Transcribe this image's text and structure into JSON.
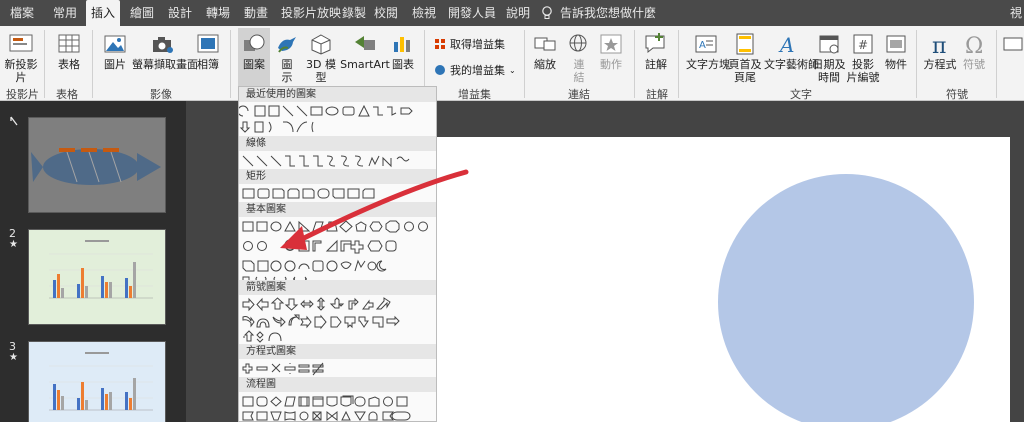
{
  "tabs": [
    "檔案",
    "常用",
    "插入",
    "繪圖",
    "設計",
    "轉場",
    "動畫",
    "投影片放映",
    "錄製",
    "校閱",
    "檢視",
    "開發人員",
    "說明"
  ],
  "active_tab": "插入",
  "tell_me": "告訴我您想做什麼",
  "right_cut_tab": "視",
  "ribbon": {
    "new_slide": [
      "新投影",
      "片"
    ],
    "table": "表格",
    "pictures": "圖片",
    "screenshot": "螢幕擷取畫面",
    "album": "相簿",
    "shapes": "圖案",
    "icons": [
      "圖",
      "示"
    ],
    "models3d": [
      "3D 模",
      "型"
    ],
    "smartart": "SmartArt",
    "chart": "圖表",
    "get_addins": "取得增益集",
    "my_addins": "我的增益集",
    "zoom": "縮放",
    "link": [
      "連",
      "結"
    ],
    "action": "動作",
    "comment": "註解",
    "textbox": "文字方塊",
    "header_footer": [
      "頁首及",
      "頁尾"
    ],
    "wordart": "文字藝術師",
    "datetime": [
      "日期及",
      "時間"
    ],
    "slide_number": [
      "投影",
      "片編號"
    ],
    "object": "物件",
    "equation": "方程式",
    "symbol": "符號",
    "groups": {
      "slides": "投影片",
      "tables": "表格",
      "images": "影像",
      "addins": "增益集",
      "links": "連結",
      "comments": "註解",
      "text": "文字",
      "symbols": "符號"
    }
  },
  "gallery": {
    "recent": "最近使用的圖案",
    "lines": "線條",
    "rectangles": "矩形",
    "basic": "基本圖案",
    "arrows": "箭號圖案",
    "equation": "方程式圖案",
    "flowchart": "流程圖"
  },
  "thumbnails": [
    {
      "num": "",
      "star": false
    },
    {
      "num": "2",
      "star": true
    },
    {
      "num": "3",
      "star": true
    }
  ],
  "colors": {
    "accent_tab": "#f3f3f3",
    "arrow": "#d9303a",
    "circle": "#b4c7e7",
    "bar_blue": "#4472c4",
    "bar_orange": "#ed7d31"
  }
}
